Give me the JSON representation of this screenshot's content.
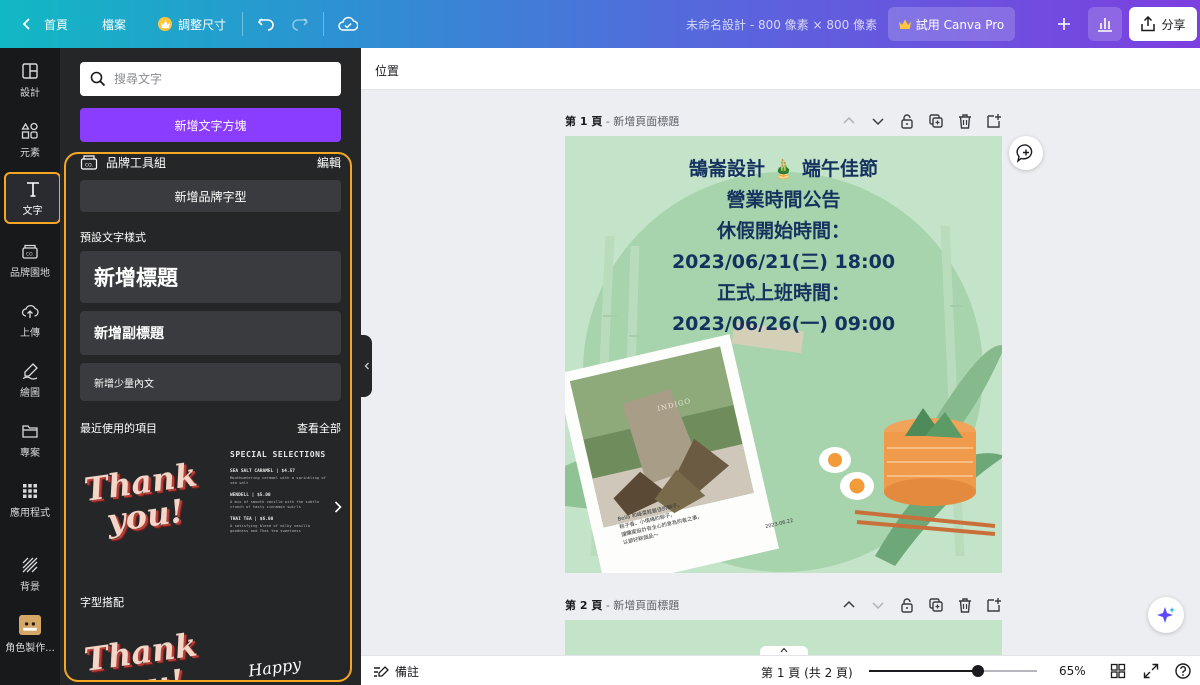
{
  "topbar": {
    "home": "首頁",
    "file": "檔案",
    "resize": "調整尺寸",
    "doc_title": "未命名設計 - 800 像素 × 800 像素",
    "try_pro": "試用 Canva Pro",
    "share": "分享"
  },
  "rail": {
    "items": [
      {
        "label": "設計"
      },
      {
        "label": "元素"
      },
      {
        "label": "文字"
      },
      {
        "label": "品牌園地"
      },
      {
        "label": "上傳"
      },
      {
        "label": "繪圖"
      },
      {
        "label": "專案"
      },
      {
        "label": "應用程式"
      },
      {
        "label": "背景"
      },
      {
        "label": "角色製作..."
      }
    ]
  },
  "panel": {
    "search_placeholder": "搜尋文字",
    "add_textbox": "新增文字方塊",
    "brand_kit": "品牌工具組",
    "edit": "編輯",
    "add_brand_font": "新增品牌字型",
    "default_styles": "預設文字樣式",
    "add_heading": "新增標題",
    "add_subheading": "新增副標題",
    "add_body": "新增少量內文",
    "recent": "最近使用的項目",
    "see_all": "查看全部",
    "thank_you": "Thank you!",
    "font_combo": "字型搭配",
    "happy": "Happy",
    "special": {
      "heading": "SPECIAL SELECTIONS",
      "items": [
        {
          "name": "SEA SALT CARAMEL  |  $4.57",
          "desc": "Mouthwatering caramel with a sprinkling of sea salt"
        },
        {
          "name": "WENDELL  |  $5.00",
          "desc": "A mix of smooth vanilla with the subtle crunch of tasty cinnamon swirls"
        },
        {
          "name": "THAI TEA  |  $6.00",
          "desc": "A satisfying blend of milky vanilla goodness and Thai tea sweetness"
        }
      ]
    }
  },
  "canvas": {
    "position": "位置",
    "page1_label": "第 1 頁",
    "page2_label": "第 2 頁",
    "page_title_placeholder": "新增頁面標題",
    "announcement": [
      "鵠崙設計 🎍 端午佳節",
      "營業時間公告",
      "休假開始時間：",
      "2023/06/21(三) 18:00",
      "正式上班時間：",
      "2023/06/26(一) 09:00"
    ],
    "photo_bag_text": "INDIGO",
    "photo_caption": "Bella 和峰菜館最佳的粽子，\n粽子香、小情緒的粽子，\n讓購案設計有全心的意為的者之事，\n以節好粽個品～",
    "photo_date": "2023.06.22"
  },
  "bottombar": {
    "notes": "備註",
    "page_count": "第 1 頁 (共 2 頁)",
    "zoom": "65%",
    "zoom_fraction": 0.65
  },
  "colors": {
    "accent": "#8b3dff",
    "highlight": "#f5a623",
    "page_bg": "#c3e4c8",
    "ann_text": "#15325f"
  }
}
